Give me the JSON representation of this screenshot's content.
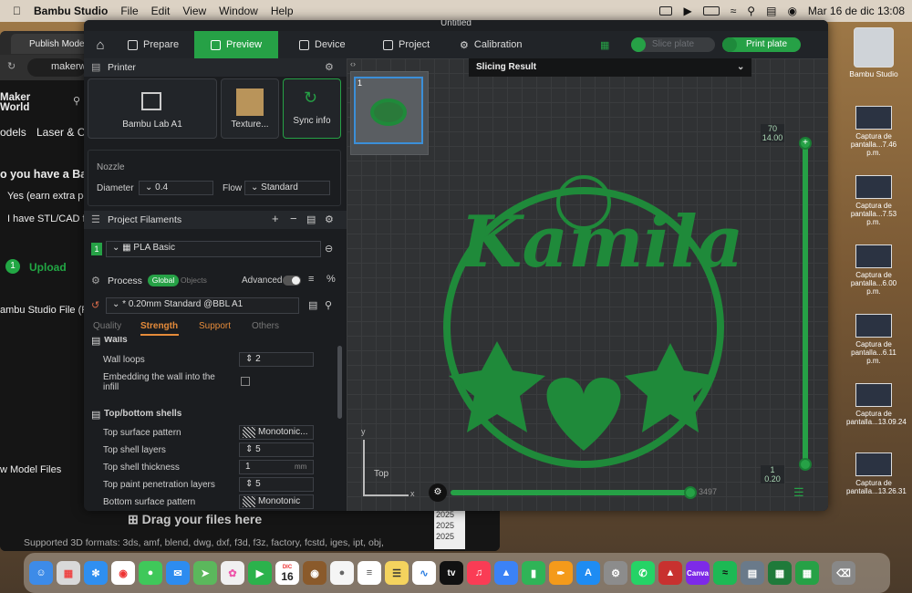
{
  "menubar": {
    "apple": "",
    "app_name": "Bambu Studio",
    "menus": [
      "File",
      "Edit",
      "View",
      "Window",
      "Help"
    ],
    "date_time": "Mar 16 de dic  13:08"
  },
  "browser": {
    "tab_title": "Publish Model",
    "url": "makerw",
    "logo": [
      "Maker",
      "World"
    ],
    "nav_items": [
      "odels",
      "Laser & Cut"
    ],
    "question": "o you have a Bam",
    "answers": [
      "Yes (earn extra poi",
      "I have STL/CAD file"
    ],
    "step_number": "1",
    "step_label": "Upload",
    "file_label": "ambu Studio File (Pri",
    "model_files": "w Model Files",
    "drag_text": "Drag your files here",
    "supported": "Supported 3D formats: 3ds, amf, blend, dwg, dxf, f3d, f3z, factory, fcstd, iges, ipt, obj,",
    "years": [
      "2025",
      "2025",
      "2025"
    ]
  },
  "window": {
    "title": "Untitled",
    "tabs": {
      "prepare": "Prepare",
      "preview": "Preview",
      "device": "Device",
      "project": "Project",
      "calibration": "Calibration"
    },
    "slice_plate": "Slice plate",
    "print_plate": "Print plate"
  },
  "printer": {
    "section": "Printer",
    "name": "Bambu Lab A1",
    "plate": "Texture...",
    "sync": "Sync info",
    "nozzle_title": "Nozzle",
    "diameter_label": "Diameter",
    "diameter": "0.4",
    "flow_label": "Flow",
    "flow": "Standard"
  },
  "filaments": {
    "section": "Project Filaments",
    "index": "1",
    "name": "PLA Basic"
  },
  "process": {
    "section": "Process",
    "global": "Global",
    "objects": "Objects",
    "advanced": "Advanced",
    "preset": "* 0.20mm Standard @BBL A1",
    "tabs": [
      "Quality",
      "Strength",
      "Support",
      "Others"
    ],
    "walls_title": "Walls",
    "wall_loops_label": "Wall loops",
    "wall_loops": "2",
    "embedding_label": "Embedding the wall into the infill",
    "top_bottom_title": "Top/bottom shells",
    "top_surface_label": "Top surface pattern",
    "top_surface": "Monotonic...",
    "top_layers_label": "Top shell layers",
    "top_layers": "5",
    "top_thickness_label": "Top shell thickness",
    "top_thickness": "1",
    "top_thickness_unit": "mm",
    "top_paint_label": "Top paint penetration layers",
    "top_paint": "5",
    "bottom_surface_label": "Bottom surface pattern",
    "bottom_surface": "Monotonic"
  },
  "viewport": {
    "slicing_result": "Slicing Result",
    "plate_number": "1",
    "model_text": "Kamila",
    "layer_top": "70",
    "height_top": "14.00",
    "layer_bottom": "1",
    "height_bottom": "0.20",
    "moves": "3497",
    "cube_label": "Top",
    "axis_x": "x",
    "axis_y": "y"
  },
  "desktop": {
    "drive": "Bambu Studio",
    "screenshots": [
      [
        "Captura de",
        "pantalla...7.46 p.m."
      ],
      [
        "Captura de",
        "pantalla...7.53 p.m."
      ],
      [
        "Captura de",
        "pantalla...6.00 p.m."
      ],
      [
        "Captura de",
        "pantalla...6.11 p.m."
      ],
      [
        "Captura de",
        "pantalla...13.09.24"
      ],
      [
        "Captura de",
        "pantalla...13.26.31"
      ]
    ]
  },
  "dock": {
    "calendar_month": "DIC",
    "calendar_day": "16",
    "tv": "tv",
    "canva": "Canva"
  },
  "colors": {
    "accent": "#26a146",
    "model": "#1f8a3a"
  }
}
